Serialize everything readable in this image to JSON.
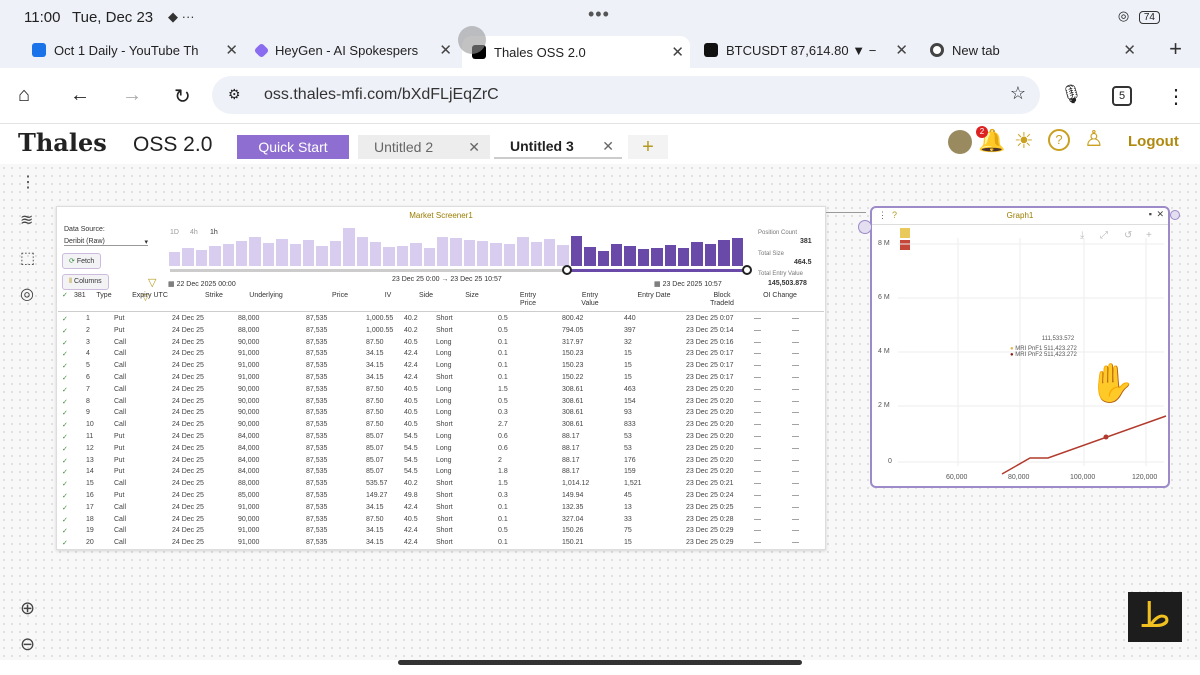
{
  "status": {
    "time": "11:00",
    "date": "Tue, Dec 23",
    "icons": "◆ ···",
    "battery": "74"
  },
  "tabs": [
    {
      "label": "Oct 1 Daily - YouTube Th",
      "color": "#1a73e8"
    },
    {
      "label": "HeyGen - AI Spokespers",
      "color": "#8a6cf0"
    },
    {
      "label": "Thales OSS 2.0",
      "color": "#000000"
    },
    {
      "label": "BTCUSDT 87,614.80 ▼ −",
      "color": "#111111"
    },
    {
      "label": "New tab",
      "color": "#444444"
    }
  ],
  "url": "oss.thales-mfi.com/bXdFLjEqZrC",
  "app": {
    "logo": "Thales",
    "subtitle": "OSS 2.0",
    "tabs": [
      "Quick Start",
      "Untitled 2",
      "Untitled 3"
    ],
    "add": "+",
    "notif_count": "2",
    "logout": "Logout"
  },
  "screener": {
    "title": "Market Screener1",
    "source_label": "Data Source:",
    "source_value": "Deribit (Raw)",
    "fetch": "Fetch",
    "columns": "Columns",
    "ranges": [
      "1D",
      "4h",
      "1h"
    ],
    "date_from": "22 Dec 2025 00:00",
    "date_range": "23 Dec 25 0:00 → 23 Dec 25 10:57",
    "date_to": "23 Dec 2025 10:57",
    "pos_count_label": "Position Count",
    "pos_count": "381",
    "total_size_label": "Total Size",
    "total_size": "464.5",
    "total_value_label": "Total Entry Value",
    "total_value": "145,503.878",
    "count": "381",
    "histogram": [
      0.35,
      0.45,
      0.4,
      0.5,
      0.55,
      0.62,
      0.72,
      0.58,
      0.68,
      0.55,
      0.65,
      0.5,
      0.62,
      0.95,
      0.72,
      0.6,
      0.48,
      0.5,
      0.58,
      0.45,
      0.72,
      0.7,
      0.66,
      0.62,
      0.58,
      0.55,
      0.72,
      0.6,
      0.68,
      0.52,
      0.75,
      0.48,
      0.38,
      0.55,
      0.5,
      0.42,
      0.46,
      0.52,
      0.44,
      0.6,
      0.55,
      0.65,
      0.7
    ],
    "headers": [
      "Type",
      "Expiry UTC",
      "Strike",
      "Underlying",
      "Price",
      "IV",
      "Side",
      "Size",
      "Entry Price",
      "Entry Value",
      "Entry Date",
      "Block TradeId",
      "OI Change"
    ],
    "rows": [
      [
        "1",
        "Put",
        "24 Dec 25",
        "88,000",
        "87,535",
        "1,000.55",
        "40.2",
        "Short",
        "0.5",
        "800.42",
        "440",
        "23 Dec 25 0:07",
        "—",
        "—"
      ],
      [
        "2",
        "Put",
        "24 Dec 25",
        "88,000",
        "87,535",
        "1,000.55",
        "40.2",
        "Short",
        "0.5",
        "794.05",
        "397",
        "23 Dec 25 0:14",
        "—",
        "—"
      ],
      [
        "3",
        "Call",
        "24 Dec 25",
        "90,000",
        "87,535",
        "87.50",
        "40.5",
        "Long",
        "0.1",
        "317.97",
        "32",
        "23 Dec 25 0:16",
        "—",
        "—"
      ],
      [
        "4",
        "Call",
        "24 Dec 25",
        "91,000",
        "87,535",
        "34.15",
        "42.4",
        "Long",
        "0.1",
        "150.23",
        "15",
        "23 Dec 25 0:17",
        "—",
        "—"
      ],
      [
        "5",
        "Call",
        "24 Dec 25",
        "91,000",
        "87,535",
        "34.15",
        "42.4",
        "Long",
        "0.1",
        "150.23",
        "15",
        "23 Dec 25 0:17",
        "—",
        "—"
      ],
      [
        "6",
        "Call",
        "24 Dec 25",
        "91,000",
        "87,535",
        "34.15",
        "42.4",
        "Short",
        "0.1",
        "150.22",
        "15",
        "23 Dec 25 0:17",
        "—",
        "—"
      ],
      [
        "7",
        "Call",
        "24 Dec 25",
        "90,000",
        "87,535",
        "87.50",
        "40.5",
        "Long",
        "1.5",
        "308.61",
        "463",
        "23 Dec 25 0:20",
        "—",
        "—"
      ],
      [
        "8",
        "Call",
        "24 Dec 25",
        "90,000",
        "87,535",
        "87.50",
        "40.5",
        "Long",
        "0.5",
        "308.61",
        "154",
        "23 Dec 25 0:20",
        "—",
        "—"
      ],
      [
        "9",
        "Call",
        "24 Dec 25",
        "90,000",
        "87,535",
        "87.50",
        "40.5",
        "Long",
        "0.3",
        "308.61",
        "93",
        "23 Dec 25 0:20",
        "—",
        "—"
      ],
      [
        "10",
        "Call",
        "24 Dec 25",
        "90,000",
        "87,535",
        "87.50",
        "40.5",
        "Short",
        "2.7",
        "308.61",
        "833",
        "23 Dec 25 0:20",
        "—",
        "—"
      ],
      [
        "11",
        "Put",
        "24 Dec 25",
        "84,000",
        "87,535",
        "85.07",
        "54.5",
        "Long",
        "0.6",
        "88.17",
        "53",
        "23 Dec 25 0:20",
        "—",
        "—"
      ],
      [
        "12",
        "Put",
        "24 Dec 25",
        "84,000",
        "87,535",
        "85.07",
        "54.5",
        "Long",
        "0.6",
        "88.17",
        "53",
        "23 Dec 25 0:20",
        "—",
        "—"
      ],
      [
        "13",
        "Put",
        "24 Dec 25",
        "84,000",
        "87,535",
        "85.07",
        "54.5",
        "Long",
        "2",
        "88.17",
        "176",
        "23 Dec 25 0:20",
        "—",
        "—"
      ],
      [
        "14",
        "Put",
        "24 Dec 25",
        "84,000",
        "87,535",
        "85.07",
        "54.5",
        "Long",
        "1.8",
        "88.17",
        "159",
        "23 Dec 25 0:20",
        "—",
        "—"
      ],
      [
        "15",
        "Call",
        "24 Dec 25",
        "88,000",
        "87,535",
        "535.57",
        "40.2",
        "Short",
        "1.5",
        "1,014.12",
        "1,521",
        "23 Dec 25 0:21",
        "—",
        "—"
      ],
      [
        "16",
        "Put",
        "24 Dec 25",
        "85,000",
        "87,535",
        "149.27",
        "49.8",
        "Short",
        "0.3",
        "149.94",
        "45",
        "23 Dec 25 0:24",
        "—",
        "—"
      ],
      [
        "17",
        "Call",
        "24 Dec 25",
        "91,000",
        "87,535",
        "34.15",
        "42.4",
        "Short",
        "0.1",
        "132.35",
        "13",
        "23 Dec 25 0:25",
        "—",
        "—"
      ],
      [
        "18",
        "Call",
        "24 Dec 25",
        "90,000",
        "87,535",
        "87.50",
        "40.5",
        "Short",
        "0.1",
        "327.04",
        "33",
        "23 Dec 25 0:28",
        "—",
        "—"
      ],
      [
        "19",
        "Call",
        "24 Dec 25",
        "91,000",
        "87,535",
        "34.15",
        "42.4",
        "Short",
        "0.5",
        "150.26",
        "75",
        "23 Dec 25 0:29",
        "—",
        "—"
      ],
      [
        "20",
        "Call",
        "24 Dec 25",
        "91,000",
        "87,535",
        "34.15",
        "42.4",
        "Short",
        "0.1",
        "150.21",
        "15",
        "23 Dec 25 0:29",
        "—",
        "—"
      ]
    ]
  },
  "graph": {
    "title": "Graph1",
    "tooltip_title": "111,533.572",
    "tooltip_1": "MRI PnF1  511,423.272",
    "tooltip_2": "MRI PnF2  511,423.272",
    "yticks": [
      "8 M",
      "6 M",
      "4 M",
      "2 M",
      "0"
    ],
    "xticks": [
      "60,000",
      "80,000",
      "100,000",
      "120,000"
    ],
    "line_color": "#b13a2c"
  },
  "brand_glyph": "ط"
}
